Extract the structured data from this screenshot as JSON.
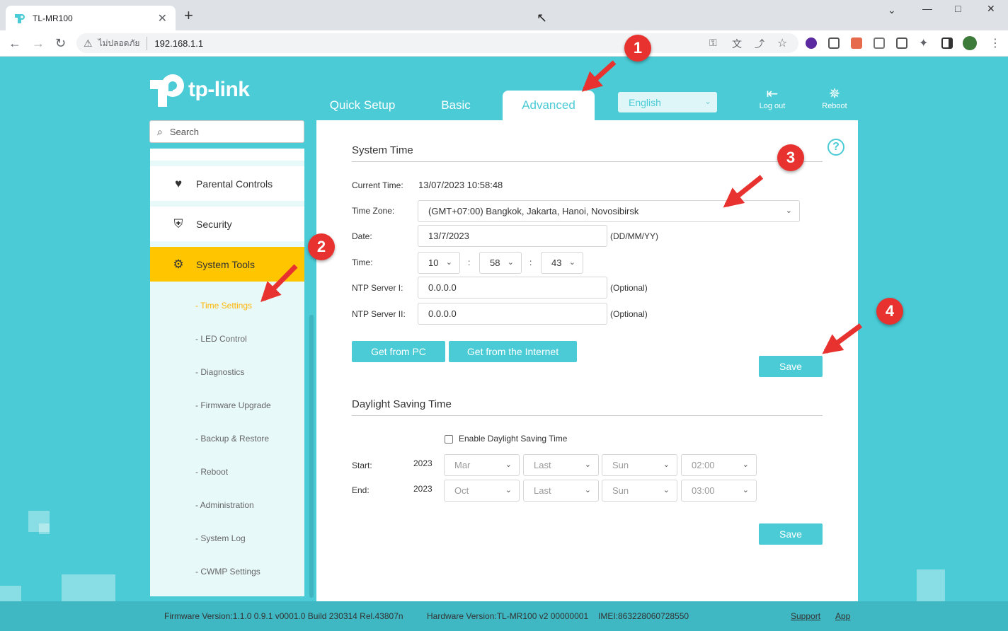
{
  "browser": {
    "tab_title": "TL-MR100",
    "tab_close": "✕",
    "new_tab": "+",
    "insecure_label": "ไม่ปลอดภัย",
    "url": "192.168.1.1"
  },
  "app": {
    "logo_text": "tp-link",
    "nav": [
      {
        "label": "Quick Setup"
      },
      {
        "label": "Basic"
      },
      {
        "label": "Advanced"
      }
    ],
    "language": "English",
    "logout_label": "Log out",
    "reboot_label": "Reboot"
  },
  "sidebar": {
    "search_placeholder": "Search",
    "items": [
      {
        "label": "Parental Controls",
        "icon": "heart-icon"
      },
      {
        "label": "Security",
        "icon": "shield-icon"
      },
      {
        "label": "System Tools",
        "icon": "gear-icon"
      }
    ],
    "subitems": [
      {
        "label": "- Time Settings"
      },
      {
        "label": "- LED Control"
      },
      {
        "label": "- Diagnostics"
      },
      {
        "label": "- Firmware Upgrade"
      },
      {
        "label": "- Backup & Restore"
      },
      {
        "label": "- Reboot"
      },
      {
        "label": "- Administration"
      },
      {
        "label": "- System Log"
      },
      {
        "label": "- CWMP Settings"
      }
    ]
  },
  "system_time": {
    "title": "System Time",
    "current_time_label": "Current Time:",
    "current_time_value": "13/07/2023 10:58:48",
    "timezone_label": "Time Zone:",
    "timezone_value": "(GMT+07:00) Bangkok, Jakarta, Hanoi, Novosibirsk",
    "date_label": "Date:",
    "date_value": "13/7/2023",
    "date_hint": "(DD/MM/YY)",
    "time_label": "Time:",
    "time_hour": "10",
    "time_min": "58",
    "time_sec": "43",
    "time_sep": ":",
    "ntp1_label": "NTP Server I:",
    "ntp1_value": "0.0.0.0",
    "ntp2_label": "NTP Server II:",
    "ntp2_value": "0.0.0.0",
    "optional_hint": "(Optional)",
    "get_pc_label": "Get from PC",
    "get_internet_label": "Get from the Internet",
    "save_label": "Save"
  },
  "dst": {
    "title": "Daylight Saving Time",
    "enable_label": "Enable Daylight Saving Time",
    "start_label": "Start:",
    "end_label": "End:",
    "start_year": "2023",
    "end_year": "2023",
    "start": {
      "month": "Mar",
      "week": "Last",
      "day": "Sun",
      "time": "02:00"
    },
    "end": {
      "month": "Oct",
      "week": "Last",
      "day": "Sun",
      "time": "03:00"
    },
    "save_label": "Save"
  },
  "footer": {
    "firmware": "Firmware Version:1.1.0 0.9.1 v0001.0 Build 230314 Rel.43807n",
    "hardware": "Hardware Version:TL-MR100 v2 00000001",
    "imei": "IMEI:863228060728550",
    "support": "Support",
    "app": "App"
  },
  "annotations": [
    "1",
    "2",
    "3",
    "4"
  ],
  "colors": {
    "accent": "#4acbd6",
    "active_menu": "#ffc600",
    "marker": "#e8322f"
  }
}
